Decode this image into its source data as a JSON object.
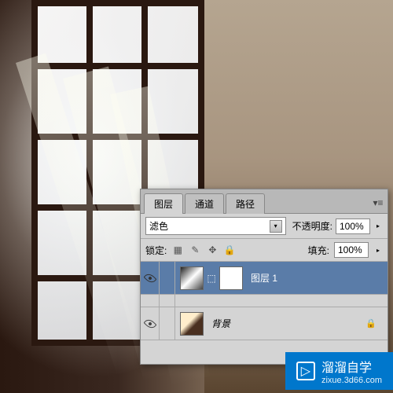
{
  "panel": {
    "tabs": {
      "layers": "图层",
      "channels": "通道",
      "paths": "路径"
    },
    "blend_mode": "滤色",
    "opacity_label": "不透明度:",
    "opacity_value": "100%",
    "lock_label": "锁定:",
    "fill_label": "填充:",
    "fill_value": "100%"
  },
  "layers": [
    {
      "name": "图层 1",
      "visible": true,
      "selected": true,
      "has_mask": true
    },
    {
      "name": "背景",
      "visible": true,
      "selected": false,
      "locked": true
    }
  ],
  "watermark": {
    "text": "溜溜自学",
    "url": "zixue.3d66.com"
  }
}
